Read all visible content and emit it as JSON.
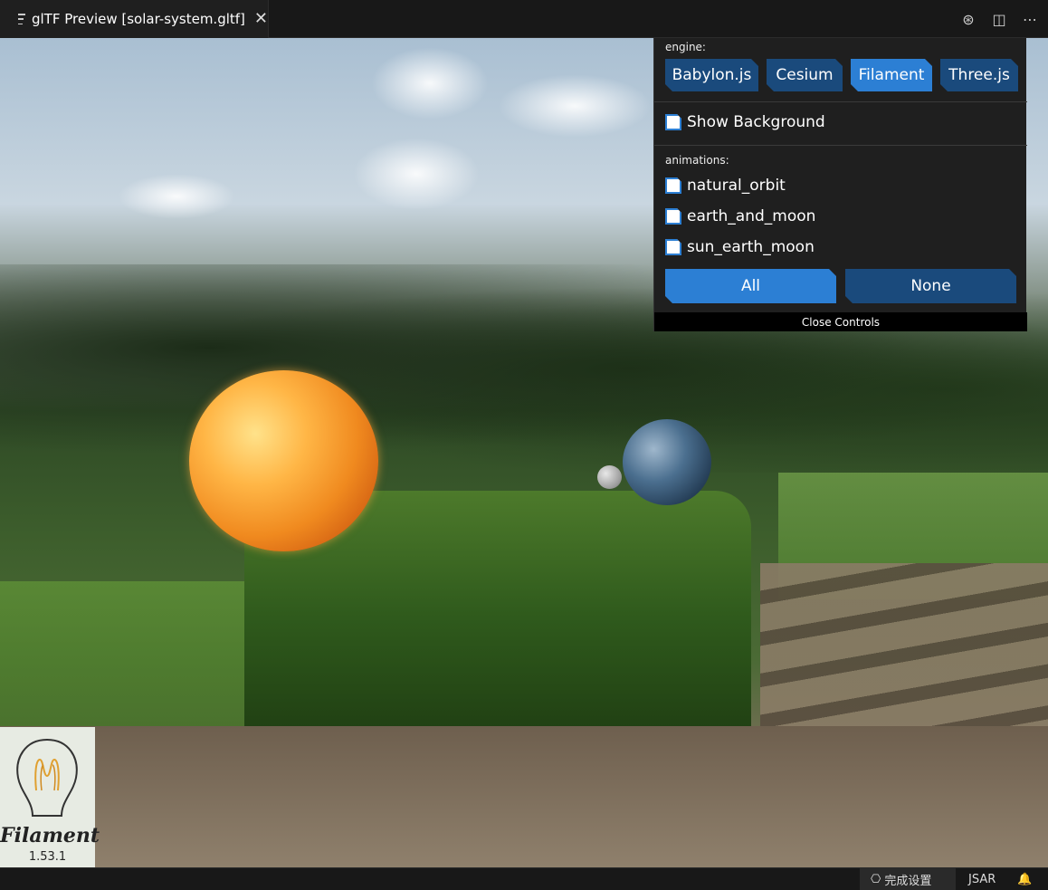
{
  "tab": {
    "title": "glTF Preview [solar-system.gltf]",
    "close": "✕"
  },
  "tab_actions": {
    "debug": "⊛",
    "split": "◫",
    "more": "⋯"
  },
  "controls": {
    "engine_label": "engine:",
    "engines": [
      {
        "label": "Babylon.js",
        "active": false
      },
      {
        "label": "Cesium",
        "active": false
      },
      {
        "label": "Filament",
        "active": true
      },
      {
        "label": "Three.js",
        "active": false
      }
    ],
    "show_background": "Show Background",
    "animations_label": "animations:",
    "animations": [
      "natural_orbit",
      "earth_and_moon",
      "sun_earth_moon"
    ],
    "all_label": "All",
    "none_label": "None",
    "close_label": "Close Controls"
  },
  "logo": {
    "name": "Filament",
    "version": "1.53.1"
  },
  "statusbar": {
    "copilot": "完成设置",
    "language": "JSAR",
    "bell": "🔔"
  },
  "colors": {
    "accent": "#2c7fd4",
    "button": "#1a4a7c",
    "panel": "#1f1f1f"
  }
}
